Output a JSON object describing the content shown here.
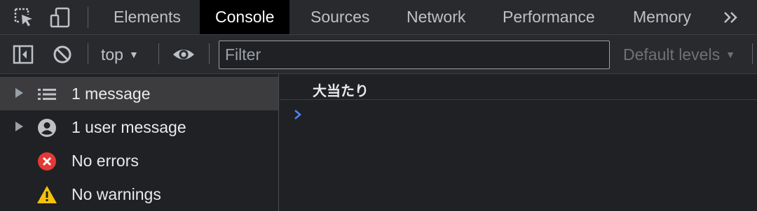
{
  "tabbar": {
    "tabs": [
      {
        "label": "Elements",
        "active": false
      },
      {
        "label": "Console",
        "active": true
      },
      {
        "label": "Sources",
        "active": false
      },
      {
        "label": "Network",
        "active": false
      },
      {
        "label": "Performance",
        "active": false
      },
      {
        "label": "Memory",
        "active": false
      }
    ],
    "more_icon": "chevron-double-right-icon"
  },
  "toolbar": {
    "context": "top",
    "filter_placeholder": "Filter",
    "filter_value": "",
    "levels": "Default levels"
  },
  "sidebar": {
    "items": [
      {
        "label": "1 message",
        "icon": "list-icon",
        "selected": true,
        "expandable": true
      },
      {
        "label": "1 user message",
        "icon": "user-icon",
        "selected": false,
        "expandable": true
      },
      {
        "label": "No errors",
        "icon": "error-icon",
        "selected": false,
        "expandable": false
      },
      {
        "label": "No warnings",
        "icon": "warning-icon",
        "selected": false,
        "expandable": false
      }
    ]
  },
  "console": {
    "messages": [
      "大当たり"
    ]
  },
  "colors": {
    "background": "#202124",
    "toolbar": "#292a2d",
    "active_tab": "#000000",
    "error": "#e53935",
    "warning": "#f4c20d",
    "prompt": "#4f83f1"
  }
}
